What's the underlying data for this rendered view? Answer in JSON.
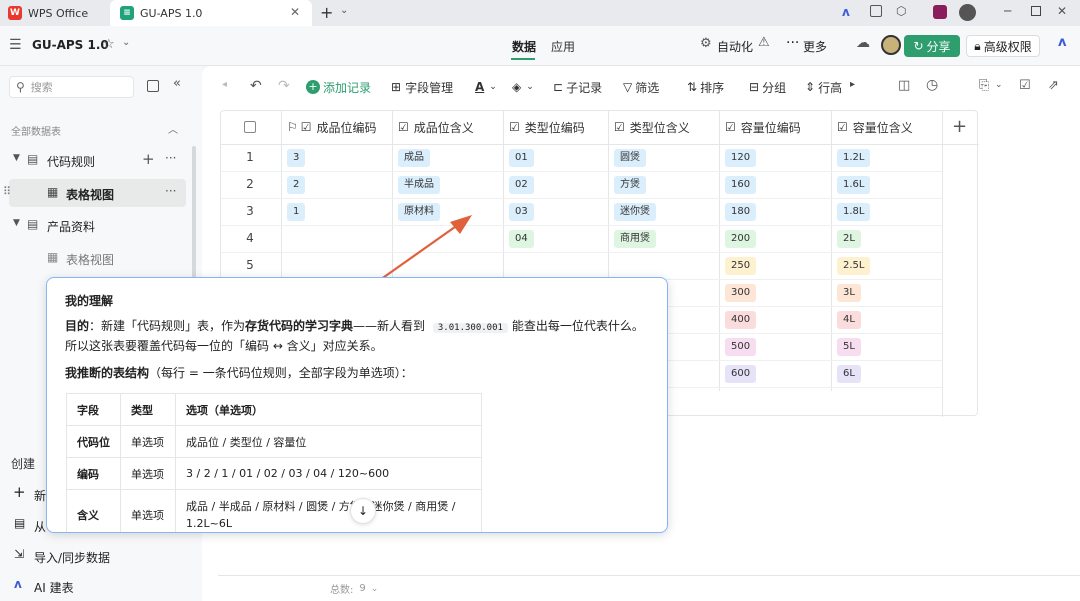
{
  "tabs": {
    "wps": "WPS Office",
    "aps": "GU-APS 1.0"
  },
  "header": {
    "title": "GU-APS 1.0",
    "tab_data": "数据",
    "tab_app": "应用",
    "automation": "自动化",
    "more": "更多",
    "share": "分享",
    "permission": "高级权限"
  },
  "sidebar": {
    "search_placeholder": "搜索",
    "section": "全部数据表",
    "items": [
      {
        "label": "代码规则"
      },
      {
        "label": "表格视图"
      },
      {
        "label": "产品资料"
      },
      {
        "label": "表格视图"
      }
    ],
    "create": "创建",
    "create_new": "新",
    "create_from": "从",
    "import": "导入/同步数据",
    "ai": "AI 建表"
  },
  "toolbar": {
    "add_record": "添加记录",
    "field_manage": "字段管理",
    "subrecord": "子记录",
    "filter": "筛选",
    "sort": "排序",
    "group": "分组",
    "row_height": "行高"
  },
  "table": {
    "headers": [
      "成品位编码",
      "成品位含义",
      "类型位编码",
      "类型位含义",
      "容量位编码",
      "容量位含义"
    ],
    "rownums": [
      "1",
      "2",
      "3",
      "4",
      "5"
    ],
    "col1": [
      "3",
      "2",
      "1"
    ],
    "col2": [
      "成品",
      "半成品",
      "原材料"
    ],
    "col3": [
      "01",
      "02",
      "03",
      "04"
    ],
    "col4": [
      "圆煲",
      "方煲",
      "迷你煲",
      "商用煲"
    ],
    "col5": [
      "120",
      "160",
      "180",
      "200",
      "250",
      "300",
      "400",
      "500",
      "600"
    ],
    "col6": [
      "1.2L",
      "1.6L",
      "1.8L",
      "2L",
      "2.5L",
      "3L",
      "4L",
      "5L",
      "6L"
    ],
    "footer_label": "总数:",
    "footer_count": "9"
  },
  "popup": {
    "title": "我的理解",
    "purpose_label": "目的",
    "purpose_a": "：新建「代码规则」表，作为",
    "purpose_bold": "存货代码的学习字典",
    "purpose_b": "——新人看到",
    "code": "3.01.300.001",
    "purpose_c": "能查出每一位代表什么。",
    "purpose_line2": "所以这张表要覆盖代码每一位的「编码 ↔ 含义」对应关系。",
    "struct_bold": "我推断的表结构",
    "struct_rest": "（每行 = 一条代码位规则，全部字段为单选项）：",
    "th": [
      "字段",
      "类型",
      "选项（单选项）"
    ],
    "rows": [
      [
        "代码位",
        "单选项",
        "成品位 / 类型位 / 容量位"
      ],
      [
        "编码",
        "单选项",
        "3 / 2 / 1 / 01 / 02 / 03 / 04 / 120~600"
      ],
      [
        "含义",
        "单选项",
        "成品 / 半成品 / 原材料 / 圆煲 / 方煲 / 迷你煲 / 商用煲 /"
      ]
    ],
    "row3_line2": "1.2L~6L"
  },
  "colors": {
    "accent": "#2e9e6f",
    "tag_blue": "#dbeefc",
    "tag_green": "#def5e2",
    "tag_yellow": "#fdf1d0",
    "tag_orange": "#fde6d6",
    "tag_red": "#fbdcdc",
    "tag_pink": "#f6def0",
    "tag_purple": "#e6e3f8",
    "arrow": "#e0603a"
  }
}
